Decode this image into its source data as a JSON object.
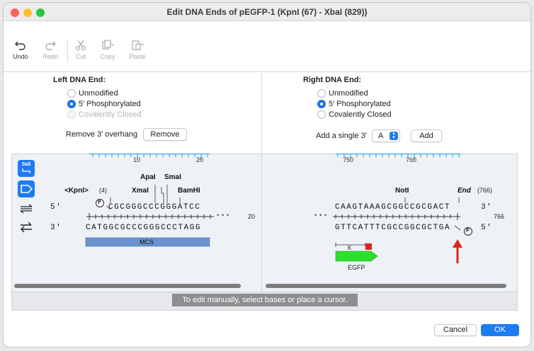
{
  "window": {
    "title": "Edit DNA Ends of pEGFP-1 (KpnI (67) - XbaI (829))"
  },
  "toolbar": {
    "undo": "Undo",
    "redo": "Redo",
    "cut": "Cut",
    "copy": "Copy",
    "paste": "Paste"
  },
  "left": {
    "heading": "Left DNA End:",
    "options": [
      "Unmodified",
      "5′ Phosphorylated",
      "Covalently Closed"
    ],
    "selected": "5′ Phosphorylated",
    "overhang_label": "Remove 3′ overhang",
    "remove_btn": "Remove"
  },
  "right": {
    "heading": "Right DNA End:",
    "options": [
      "Unmodified",
      "5′ Phosphorylated",
      "Covalently Closed"
    ],
    "selected": "5′ Phosphorylated",
    "add_label": "Add a single 3′",
    "base_value": "A",
    "add_btn": "Add"
  },
  "seq_left": {
    "ruler": [
      "10",
      "20"
    ],
    "enzymes": {
      "kpn": "<KpnI>",
      "kpn_pos": "(4)",
      "apa": "ApaI",
      "sma": "SmaI",
      "xma": "XmaI",
      "bam": "BamHI"
    },
    "top_label": "5'",
    "bottom_label": "3'",
    "top": "CGCGGGCCCGGGATCC",
    "bottom": "CATGGCGCCCGGGCCCTAGG",
    "end_num": "20",
    "feature": "MCS",
    "phospho": "P",
    "ellipsis": "•••"
  },
  "seq_right": {
    "ruler": [
      "750",
      "760"
    ],
    "enzymes": {
      "not": "NotI",
      "end": "End",
      "end_pos": "(766)"
    },
    "top_label": "3'",
    "bottom_label": "5'",
    "top": "CAAGTAAAGCGGCCGCGACT",
    "bottom": "GTTCATTTCGCCGGCGCTGA",
    "end_num": "766",
    "feature": "EGFP",
    "feature_k": "K",
    "phospho": "P",
    "ellipsis": "•••"
  },
  "side_tools": {
    "sal": "SalI"
  },
  "status": "To edit manually, select bases or place a cursor.",
  "footer": {
    "cancel": "Cancel",
    "ok": "OK"
  },
  "colors": {
    "accent": "#1e7cf2",
    "ruler": "#1aa0d8",
    "mcs": "#6b93cf",
    "egfp": "#2ee02e",
    "arrow": "#e2231a"
  }
}
